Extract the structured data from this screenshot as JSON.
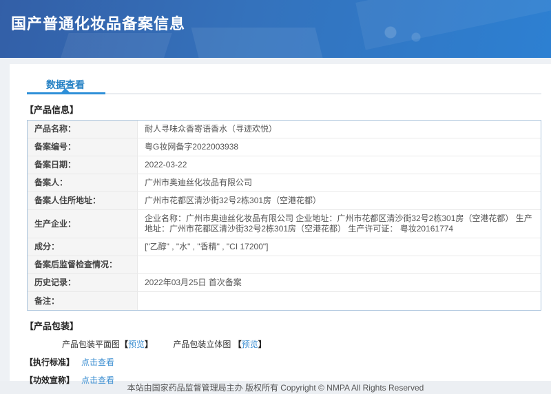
{
  "banner": {
    "title": "国产普通化妆品备案信息"
  },
  "tabs": {
    "data_view": "数据查看"
  },
  "sections": {
    "product_info": "【产品信息】",
    "product_packaging": "【产品包装】",
    "execution_standard": "【执行标准】",
    "efficacy_claim": "【功效宣称】"
  },
  "product_info_table": {
    "rows": [
      {
        "label": "产品名称：",
        "value": "耐人寻味众香寄语香水（寻迹欢悦）"
      },
      {
        "label": "备案编号：",
        "value": "粤G妆网备字2022003938"
      },
      {
        "label": "备案日期：",
        "value": "2022-03-22"
      },
      {
        "label": "备案人：",
        "value": "广州市奥迪丝化妆品有限公司"
      },
      {
        "label": "备案人住所地址：",
        "value": "广州市花都区清沙街32号2栋301房（空港花都）"
      },
      {
        "label": "生产企业：",
        "value": "企业名称：广州市奥迪丝化妆品有限公司 企业地址：广州市花都区清沙街32号2栋301房（空港花都） 生产地址：广州市花都区清沙街32号2栋301房（空港花都） 生产许可证： 粤妆20161774"
      },
      {
        "label": "成分：",
        "value": "[\"乙醇\" , \"水\" , \"香精\" , \"CI 17200\"]"
      },
      {
        "label": "备案后监督检查情况：",
        "value": ""
      },
      {
        "label": "历史记录：",
        "value": "2022年03月25日 首次备案"
      },
      {
        "label": "备注：",
        "value": ""
      }
    ]
  },
  "packaging": {
    "flat_label": "产品包装平面图",
    "stereo_label": "产品包装立体图 ",
    "bracket_open": "【",
    "bracket_close": "】",
    "preview_link": "预览"
  },
  "links": {
    "click_to_view": "点击查看"
  },
  "footer": {
    "text": "本站由国家药品监督管理局主办 版权所有 Copyright © NMPA All Rights Reserved"
  },
  "colors": {
    "banner_top": "#335fa7",
    "banner_bottom": "#2d80d2",
    "accent_blue": "#2e8fd8",
    "tab_text": "#2581c4",
    "link_blue": "#3d8fd2",
    "table_border": "#abc4dc",
    "row_border": "#e9e9e9",
    "label_bg": "#f5f5f5",
    "page_bg": "#eef1f5",
    "footer_bg": "#eceff3"
  }
}
